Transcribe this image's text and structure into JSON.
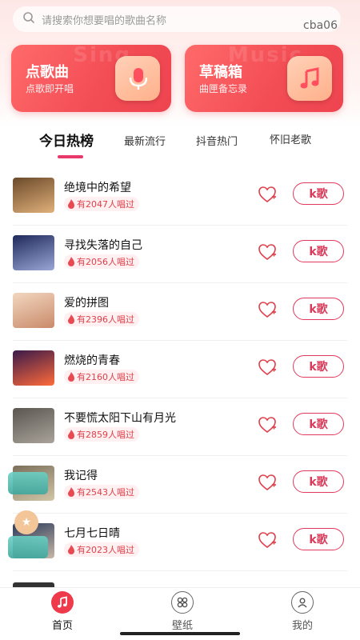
{
  "header": {
    "search_placeholder": "请搜索你想要唱的歌曲名称",
    "user_id": "cba06"
  },
  "cards": [
    {
      "title": "点歌曲",
      "subtitle": "点歌即开唱",
      "bg_text": "Sing",
      "icon": "microphone-icon"
    },
    {
      "title": "草稿箱",
      "subtitle": "曲匣备忘录",
      "bg_text": "Music",
      "icon": "music-note-icon"
    }
  ],
  "tabs": [
    {
      "label": "今日热榜",
      "active": true
    },
    {
      "label": "最新流行",
      "active": false
    },
    {
      "label": "抖音热门",
      "active": false
    },
    {
      "label": "怀旧老歌",
      "active": false
    }
  ],
  "songs": [
    {
      "title": "绝境中的希望",
      "sung": "有2047人唱过",
      "cover_colors": [
        "#6b4a2a",
        "#e0b07a"
      ]
    },
    {
      "title": "寻找失落的自己",
      "sung": "有2056人唱过",
      "cover_colors": [
        "#1f2a5a",
        "#9aa7d6"
      ]
    },
    {
      "title": "爱的拼图",
      "sung": "有2396人唱过",
      "cover_colors": [
        "#f2d7c0",
        "#c98a6a"
      ]
    },
    {
      "title": "燃烧的青春",
      "sung": "有2160人唱过",
      "cover_colors": [
        "#3a1a4a",
        "#ff6a3a"
      ]
    },
    {
      "title": "不要慌太阳下山有月光",
      "sung": "有2859人唱过",
      "cover_colors": [
        "#5a5650",
        "#a9a39a"
      ]
    },
    {
      "title": "我记得",
      "sung": "有2543人唱过",
      "cover_colors": [
        "#7c6f5a",
        "#d2c6a8"
      ]
    },
    {
      "title": "七月七日晴",
      "sung": "有2023人唱过",
      "cover_colors": [
        "#2a3a5a",
        "#c7b8a8"
      ]
    }
  ],
  "k_button_label": "k歌",
  "nav": [
    {
      "label": "首页",
      "icon": "music-note-icon",
      "active": true
    },
    {
      "label": "壁纸",
      "icon": "wallpaper-icon",
      "active": false
    },
    {
      "label": "我的",
      "icon": "profile-icon",
      "active": false
    }
  ],
  "colors": {
    "accent": "#e8396a",
    "card_red": "#f24c54",
    "sung_text": "#e0404a"
  }
}
